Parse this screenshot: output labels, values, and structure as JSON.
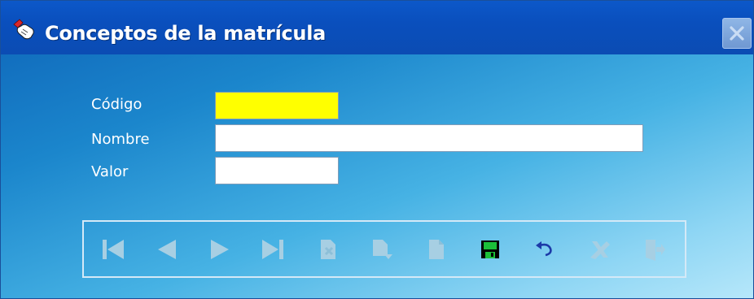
{
  "window": {
    "title": "Conceptos de la matrícula",
    "icon": "hand-pointer-icon"
  },
  "form": {
    "codigo": {
      "label": "Código",
      "value": ""
    },
    "nombre": {
      "label": "Nombre",
      "value": ""
    },
    "valor": {
      "label": "Valor",
      "value": ""
    }
  },
  "toolbar": {
    "buttons": [
      {
        "name": "first-record",
        "icon": "skip-first-icon",
        "enabled": false
      },
      {
        "name": "previous-record",
        "icon": "triangle-left-icon",
        "enabled": false
      },
      {
        "name": "next-record",
        "icon": "triangle-right-icon",
        "enabled": false
      },
      {
        "name": "last-record",
        "icon": "skip-last-icon",
        "enabled": false
      },
      {
        "name": "new-record",
        "icon": "new-document-icon",
        "enabled": false
      },
      {
        "name": "edit-record",
        "icon": "edit-document-icon",
        "enabled": false
      },
      {
        "name": "search-record",
        "icon": "document-icon",
        "enabled": false
      },
      {
        "name": "save",
        "icon": "floppy-disk-icon",
        "enabled": true
      },
      {
        "name": "undo",
        "icon": "undo-arrow-icon",
        "enabled": true
      },
      {
        "name": "delete",
        "icon": "delete-icon",
        "enabled": false
      },
      {
        "name": "exit",
        "icon": "exit-door-icon",
        "enabled": false
      }
    ]
  },
  "colors": {
    "title_bar": "#0b52c0",
    "required_field": "#ffff00",
    "disabled_icon": "#9cc4dc",
    "save_icon": "#008000",
    "undo_icon": "#1c3aa8"
  }
}
